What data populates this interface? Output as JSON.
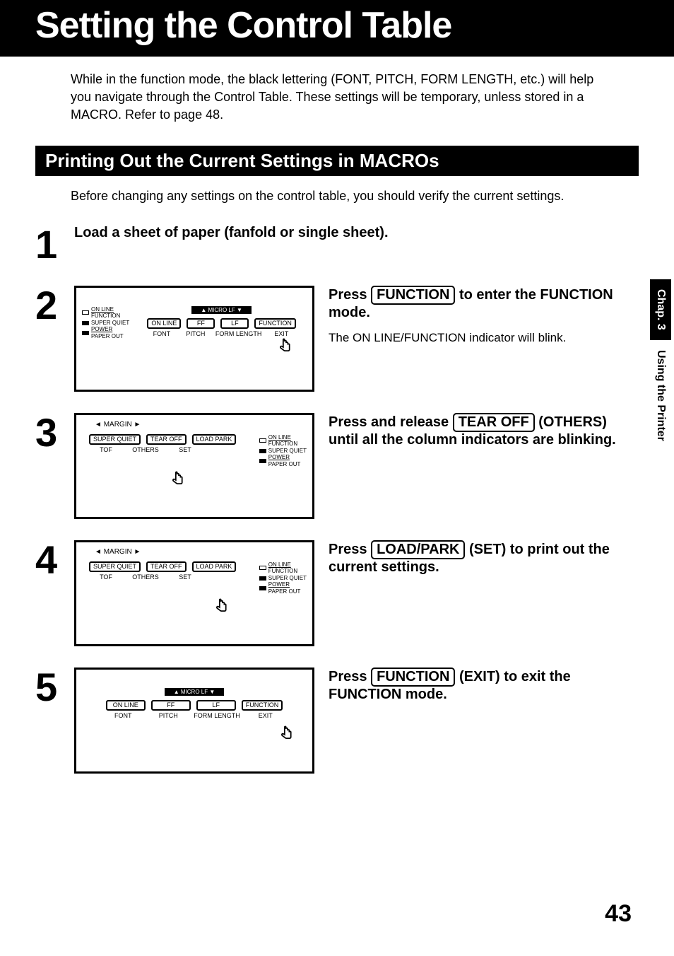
{
  "header": {
    "title": "Setting the Control Table"
  },
  "intro": "While in the function mode, the black lettering (FONT, PITCH, FORM LENGTH, etc.) will help you navigate through the Control Table. These settings will be temporary, unless stored in a MACRO. Refer to page 48.",
  "subheading": {
    "title": "Printing Out the Current Settings in MACROs",
    "intro": "Before changing any settings on the control table, you should verify the current settings."
  },
  "steps": [
    {
      "num": "1",
      "instruction": "Load a sheet of paper (fanfold or single sheet).",
      "hasFigure": false
    },
    {
      "num": "2",
      "instruction_pre": "Press ",
      "instruction_key": "FUNCTION",
      "instruction_post": " to enter the FUNCTION mode.",
      "sub": "The ON LINE/FUNCTION indicator will blink.",
      "hasFigure": true,
      "figure": "panelA"
    },
    {
      "num": "3",
      "instruction_pre": "Press and release ",
      "instruction_key": "TEAR OFF",
      "instruction_post": " (OTHERS) until all the column indicators are blinking.",
      "hasFigure": true,
      "figure": "panelB"
    },
    {
      "num": "4",
      "instruction_pre": "Press ",
      "instruction_key": "LOAD/PARK",
      "instruction_post": " (SET) to print out the current settings.",
      "hasFigure": true,
      "figure": "panelB2"
    },
    {
      "num": "5",
      "instruction_pre": "Press ",
      "instruction_key": "FUNCTION",
      "instruction_post": " (EXIT) to exit the FUNCTION mode.",
      "hasFigure": true,
      "figure": "panelC"
    }
  ],
  "panel": {
    "microLabel": "▲ MICRO LF ▼",
    "marginLabel": "MARGIN",
    "buttonsA": [
      "ON LINE",
      "FF",
      "LF",
      "FUNCTION"
    ],
    "labelsA": [
      "FONT",
      "PITCH",
      "FORM LENGTH",
      "EXIT"
    ],
    "buttonsB": [
      "SUPER QUIET",
      "TEAR OFF",
      "LOAD PARK"
    ],
    "labelsB_others": [
      "TOF",
      "OTHERS",
      "SET"
    ],
    "labelsB_set": [
      "TOF",
      "OTHERS",
      "SET"
    ],
    "indicators": [
      {
        "l1": "ON LINE",
        "l2": "FUNCTION"
      },
      {
        "l1": "SUPER QUIET",
        "l2": ""
      },
      {
        "l1": "POWER",
        "l2": "PAPER OUT"
      }
    ]
  },
  "sideTabs": {
    "chap": "Chap. 3",
    "section": "Using the Printer"
  },
  "pageNumber": "43"
}
